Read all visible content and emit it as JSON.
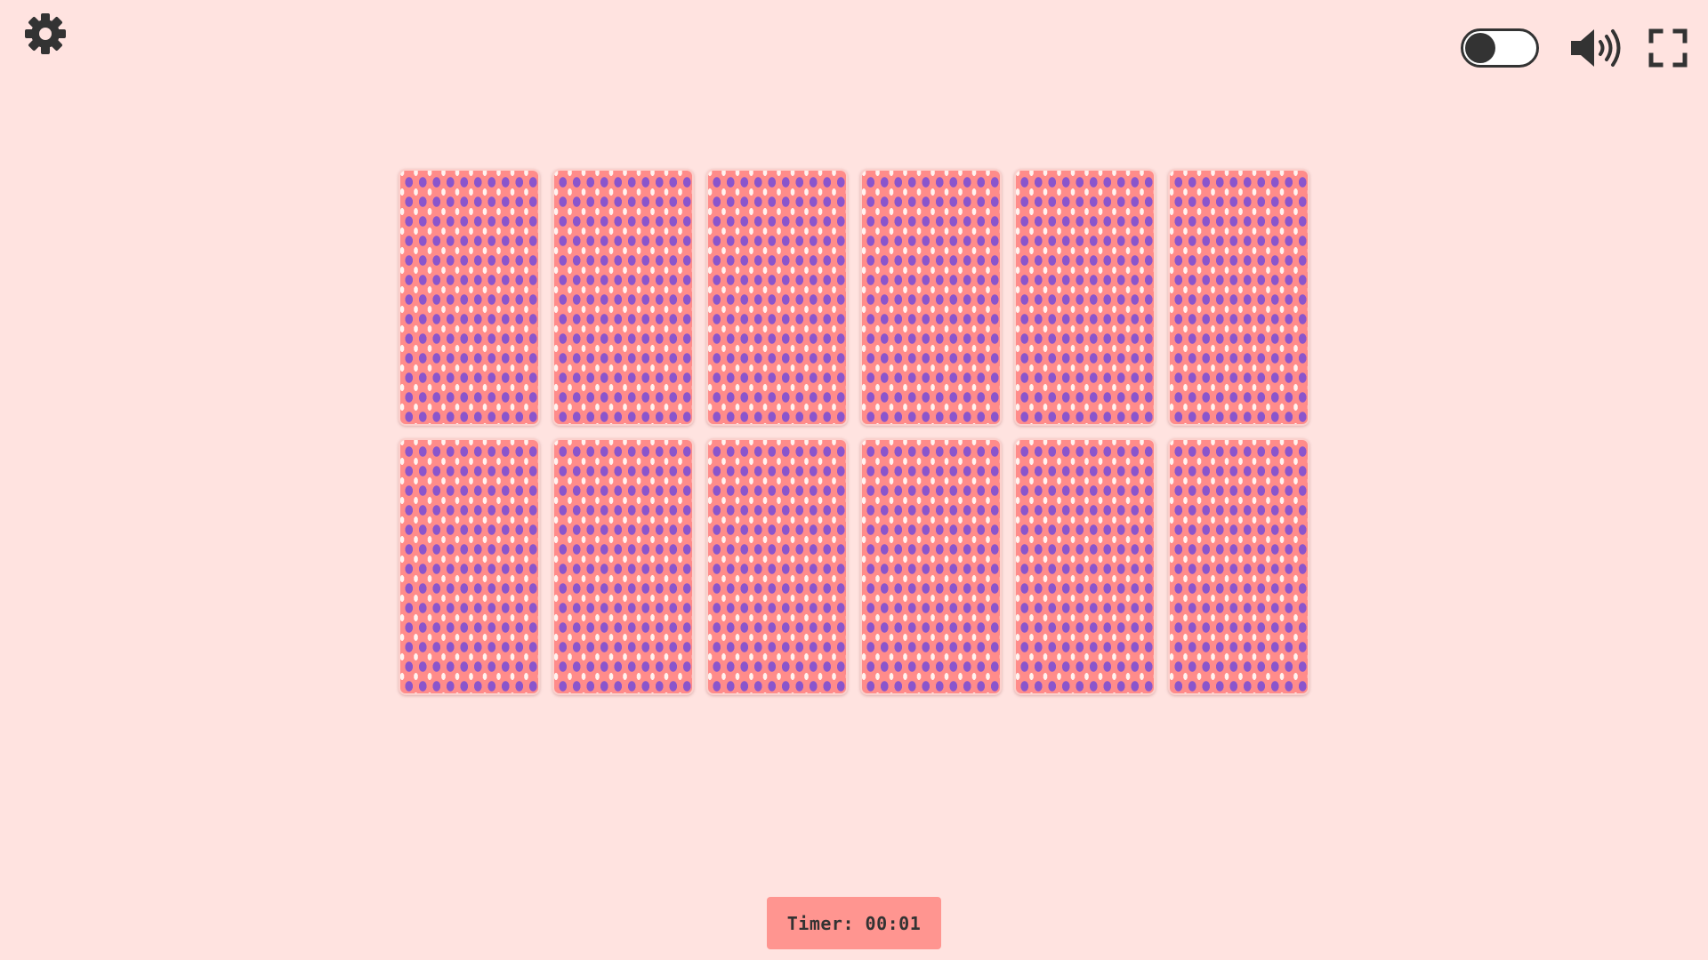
{
  "controls": {
    "settings_icon": "gear-icon",
    "theme_toggle": {
      "state": "off"
    },
    "sound_icon": "speaker-icon",
    "fullscreen_icon": "fullscreen-icon"
  },
  "board": {
    "rows": 2,
    "columns": 6,
    "cards": [
      {
        "face": "down"
      },
      {
        "face": "down"
      },
      {
        "face": "down"
      },
      {
        "face": "down"
      },
      {
        "face": "down"
      },
      {
        "face": "down"
      },
      {
        "face": "down"
      },
      {
        "face": "down"
      },
      {
        "face": "down"
      },
      {
        "face": "down"
      },
      {
        "face": "down"
      },
      {
        "face": "down"
      }
    ]
  },
  "timer": {
    "label": "Timer: 00:01"
  },
  "colors": {
    "background": "#ffe3e0",
    "card_back": "#ff8c8a",
    "card_dot_purple": "#8a55cc",
    "card_dot_white": "#fff3ef",
    "timer_bg": "#ff9590",
    "icon": "#333333"
  }
}
